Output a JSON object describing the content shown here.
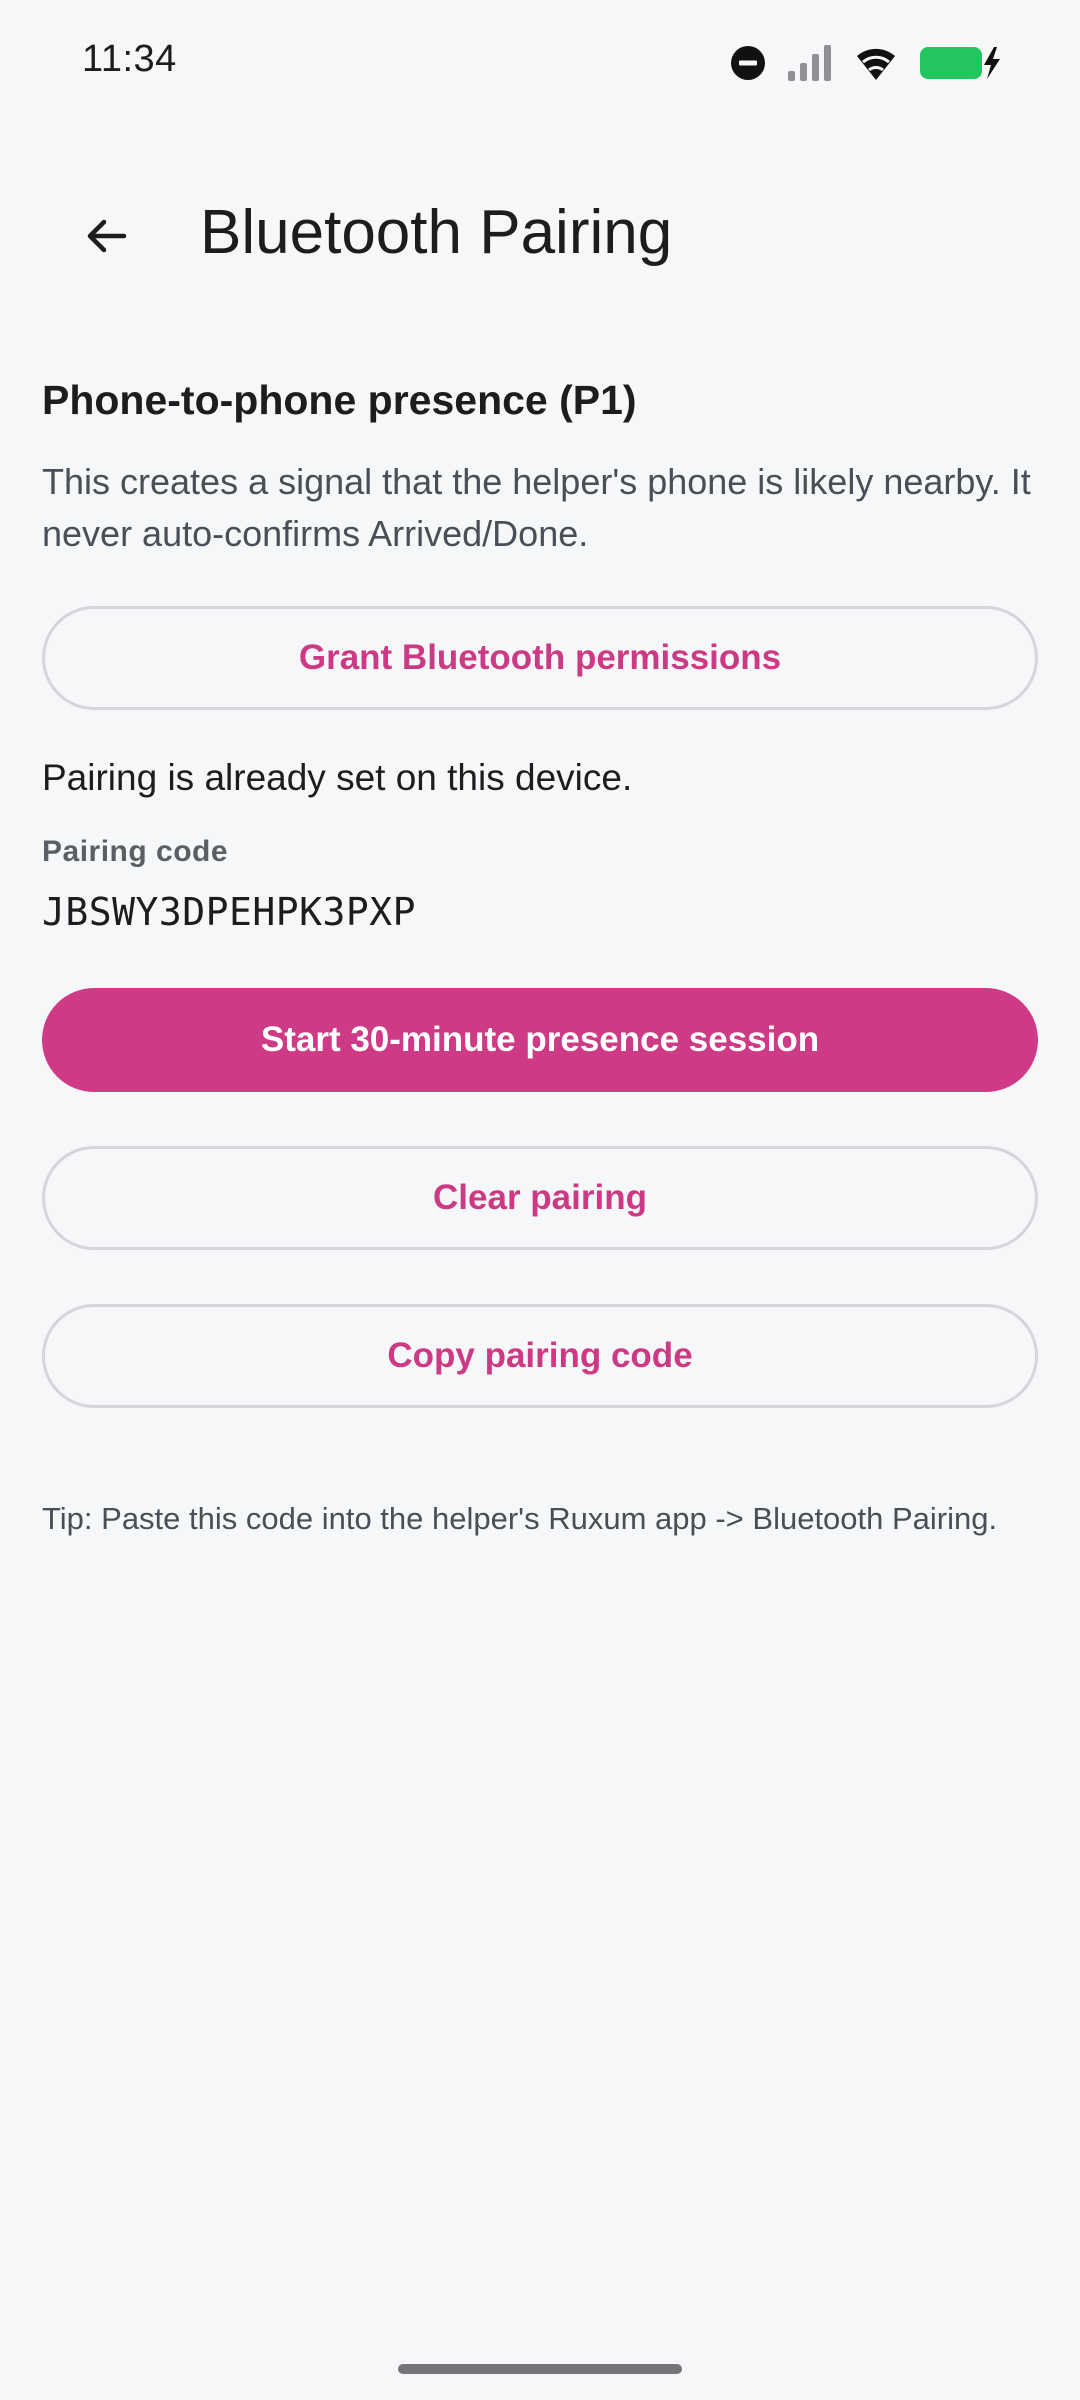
{
  "status_bar": {
    "time": "11:34",
    "icons": [
      "do-not-disturb-icon",
      "cellular-signal-icon",
      "wifi-icon",
      "battery-charging-icon"
    ],
    "battery_color": "#22c55e"
  },
  "app_bar": {
    "back_icon": "arrow-back-icon",
    "title": "Bluetooth Pairing"
  },
  "presence": {
    "title": "Phone-to-phone presence (P1)",
    "description": "This creates a signal that the helper's phone is likely nearby. It never auto-confirms Arrived/Done.",
    "grant_button_label": "Grant Bluetooth permissions",
    "pairing_status": "Pairing is already set on this device.",
    "pairing_code_label": "Pairing code",
    "pairing_code": "JBSWY3DPEHPK3PXP",
    "start_button_label": "Start 30-minute presence session",
    "clear_button_label": "Clear pairing",
    "copy_button_label": "Copy pairing code",
    "tip": "Tip: Paste this code into the helper's Ruxum app -> Bluetooth Pairing."
  },
  "colors": {
    "accent": "#cf3a86",
    "background": "#f6f7f9",
    "outline": "#d5d6da"
  }
}
